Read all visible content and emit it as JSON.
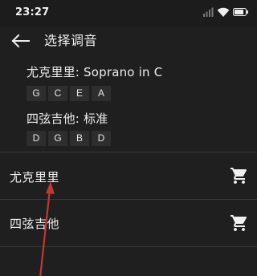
{
  "status_bar": {
    "time": "23:27",
    "icons": [
      "signal-icon",
      "wifi-icon",
      "battery-icon"
    ]
  },
  "toolbar": {
    "back_icon": "arrow-left-icon",
    "title": "选择调音"
  },
  "current_tunings": [
    {
      "title": "尤克里里: Soprano in C",
      "notes": [
        "G",
        "C",
        "E",
        "A"
      ]
    },
    {
      "title": "四弦吉他: 标准",
      "notes": [
        "D",
        "G",
        "B",
        "D"
      ]
    }
  ],
  "instruments": [
    {
      "label": "尤克里里",
      "action_icon": "shopping-cart-icon"
    },
    {
      "label": "四弦吉他",
      "action_icon": "shopping-cart-icon"
    }
  ],
  "colors": {
    "background": "#1f1f1f",
    "chip_background": "#2e2e2e",
    "divider": "#3a3a3a",
    "annotation_arrow": "#c0392b"
  }
}
